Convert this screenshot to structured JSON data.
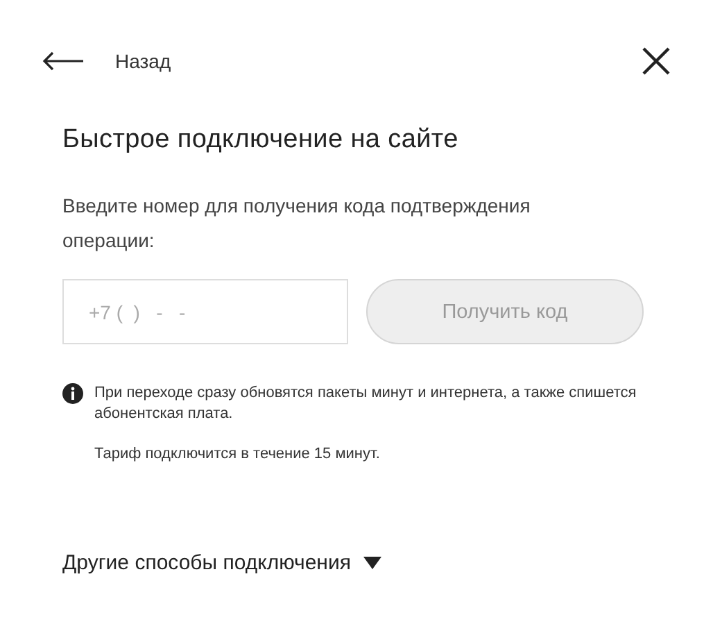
{
  "header": {
    "back_label": "Назад"
  },
  "title": "Быстрое подключение на сайте",
  "prompt": "Введите номер для получения кода подтверждения операции:",
  "phone_field": {
    "placeholder": "+7 (  )   -   -"
  },
  "submit_button": {
    "label": "Получить код",
    "disabled": true
  },
  "notes": [
    {
      "text": "При переходе сразу обновятся пакеты минут и интернета, а также спишется абонентская плата.",
      "kind": "info"
    },
    {
      "text": "Тариф подключится в течение 15 минут.",
      "kind": "plain"
    }
  ],
  "other_methods": {
    "label": "Другие способы подключения",
    "expanded": false
  }
}
